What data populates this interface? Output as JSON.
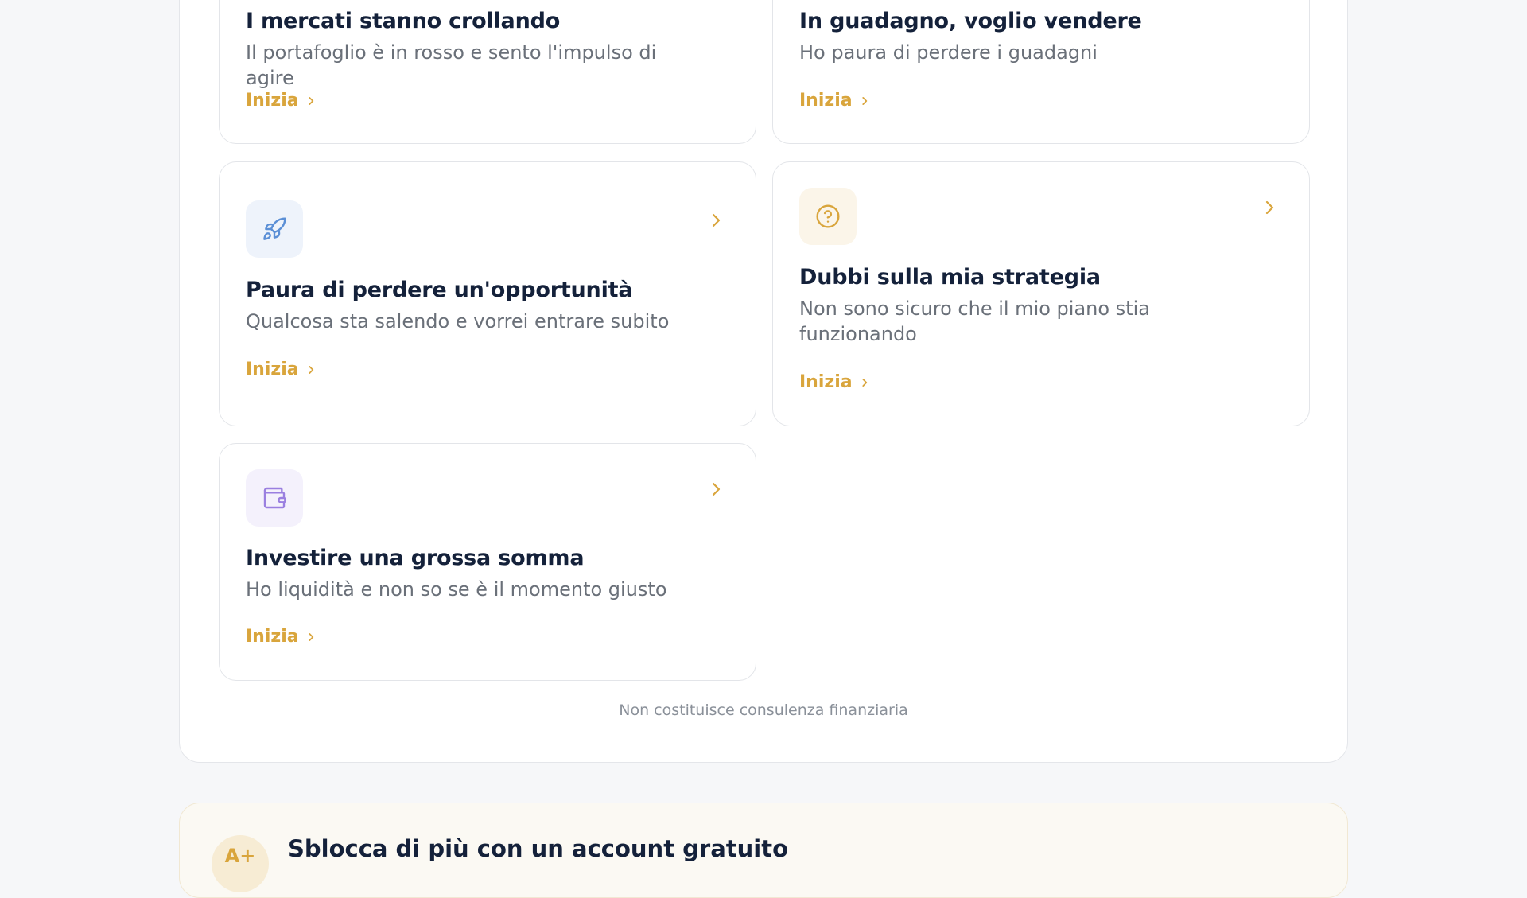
{
  "cards": [
    {
      "title": "I mercati stanno crollando",
      "description": "Il portafoglio è in rosso e sento l'impulso di agire",
      "cta": "Inizia"
    },
    {
      "title": "In guadagno, voglio vendere",
      "description": "Ho paura di perdere i guadagni",
      "cta": "Inizia"
    },
    {
      "title": "Paura di perdere un'opportunità",
      "description": "Qualcosa sta salendo e vorrei entrare subito",
      "cta": "Inizia",
      "icon": "rocket-icon",
      "icon_color": "#5b8fd6",
      "icon_bg": "#eef3fb"
    },
    {
      "title": "Dubbi sulla mia strategia",
      "description": "Non sono sicuro che il mio piano stia funzionando",
      "cta": "Inizia",
      "icon": "question-circle-icon",
      "icon_color": "#d9a53c",
      "icon_bg": "#fbf5e9"
    },
    {
      "title": "Investire una grossa somma",
      "description": "Ho liquidità e non so se è il momento giusto",
      "cta": "Inizia",
      "icon": "wallet-icon",
      "icon_color": "#9a7fe0",
      "icon_bg": "#f4f1fc"
    }
  ],
  "disclaimer": "Non costituisce consulenza finanziaria",
  "promo": {
    "icon_text": "A+",
    "title": "Sblocca di più con un account gratuito"
  },
  "colors": {
    "accent": "#d9a53c",
    "heading": "#14213a",
    "muted": "#6a7079"
  }
}
